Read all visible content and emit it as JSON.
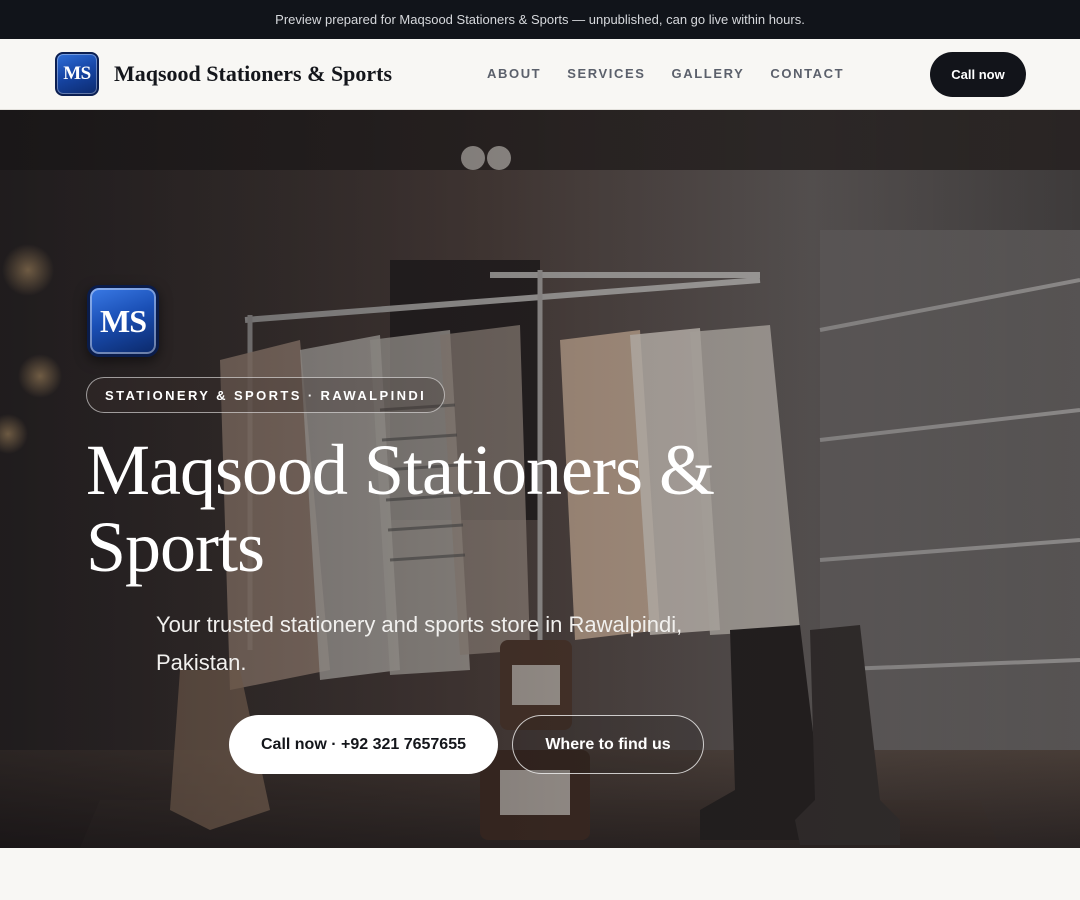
{
  "preview_banner": {
    "text": "Preview prepared for Maqsood Stationers & Sports — unpublished, can go live within hours."
  },
  "header": {
    "logo_initials": "MS",
    "brand_name": "Maqsood Stationers & Sports",
    "nav": [
      {
        "label": "ABOUT"
      },
      {
        "label": "SERVICES"
      },
      {
        "label": "GALLERY"
      },
      {
        "label": "CONTACT"
      }
    ],
    "cta_label": "Call now"
  },
  "hero": {
    "logo_initials": "MS",
    "tagline": "STATIONERY & SPORTS · RAWALPINDI",
    "title": "Maqsood Stationers & Sports",
    "subtitle": "Your trusted stationery and sports store in Rawalpindi, Pakistan.",
    "primary_button": "Call now · +92 321 7657655",
    "secondary_button": "Where to find us"
  },
  "colors": {
    "dark": "#12141a",
    "logo_blue": "#1a4fb5",
    "background": "#f8f7f4"
  }
}
